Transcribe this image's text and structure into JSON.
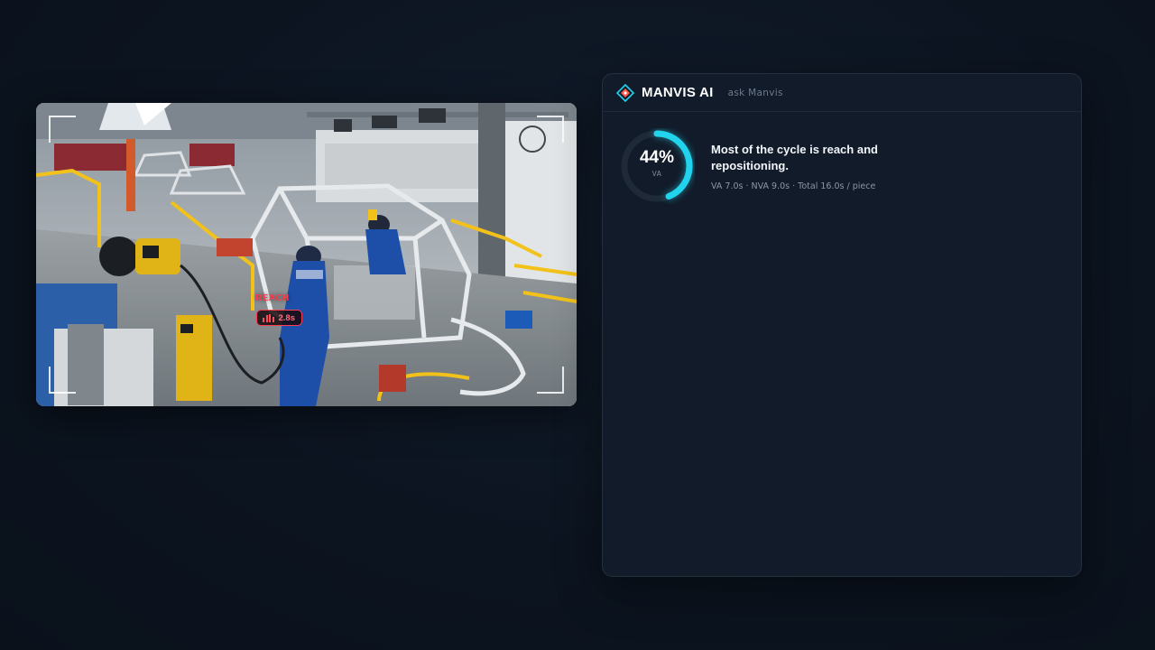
{
  "video": {
    "tag": {
      "label": "REACH",
      "duration": "2.8s"
    }
  },
  "assistant": {
    "brand": "MANVIS AI",
    "ask_label": "ask Manvis",
    "gauge": {
      "value_label": "44%",
      "value_fraction": 0.44,
      "sub_label": "VA"
    },
    "headline": "Most of the cycle is reach and repositioning.",
    "metrics": "VA 7.0s · NVA 9.0s · Total 16.0s / piece"
  },
  "colors": {
    "accent": "#22d3ee",
    "alert": "#ff3b4e",
    "panel": "#111b29",
    "background": "#0d1522"
  },
  "icons": [
    "manvis-logo-icon",
    "bar-chart-icon"
  ]
}
